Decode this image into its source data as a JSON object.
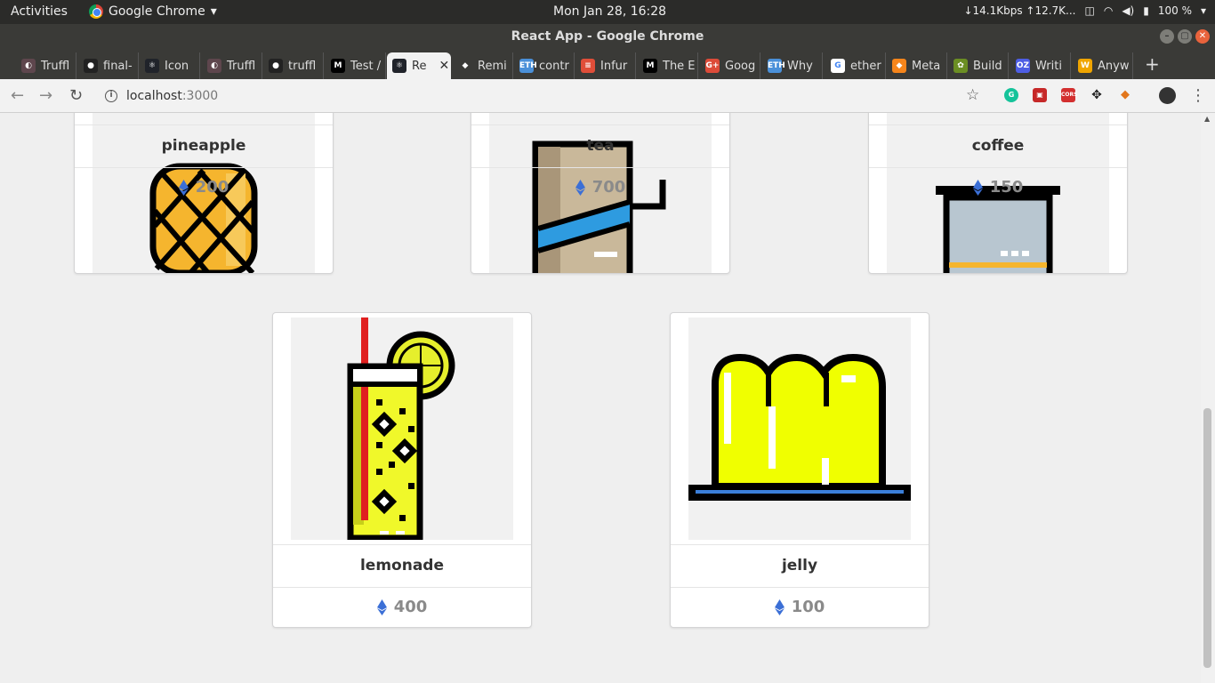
{
  "system": {
    "activities": "Activities",
    "app_name": "Google Chrome",
    "clock": "Mon Jan 28, 16:28",
    "net": "↓14.1Kbps ↑12.7K...",
    "battery": "100 %"
  },
  "window": {
    "title": "React App - Google Chrome"
  },
  "tabs": [
    {
      "label": "Truffl",
      "fav": "truffle-icon"
    },
    {
      "label": "final-",
      "fav": "github-icon"
    },
    {
      "label": "Icon",
      "fav": "react-icon"
    },
    {
      "label": "Truffl",
      "fav": "truffle-icon"
    },
    {
      "label": "truffl",
      "fav": "github-icon"
    },
    {
      "label": "Test /",
      "fav": "medium-icon"
    },
    {
      "label": "Re",
      "fav": "react-icon",
      "active": true
    },
    {
      "label": "Remi",
      "fav": "remix-icon"
    },
    {
      "label": "contr",
      "fav": "eth-icon"
    },
    {
      "label": "Infur",
      "fav": "infura-icon"
    },
    {
      "label": "The E",
      "fav": "medium-icon"
    },
    {
      "label": "Goog",
      "fav": "gplus-icon"
    },
    {
      "label": "Why",
      "fav": "eth-icon"
    },
    {
      "label": "ether",
      "fav": "google-icon"
    },
    {
      "label": "Meta",
      "fav": "metamask-icon"
    },
    {
      "label": "Build",
      "fav": "build-icon"
    },
    {
      "label": "Writi",
      "fav": "openzeppelin-icon"
    },
    {
      "label": "Anyw",
      "fav": "w-icon"
    }
  ],
  "address_bar": {
    "host": "localhost",
    "port": ":3000"
  },
  "products": [
    {
      "name": "pineapple",
      "price": "200",
      "image": "pineapple-image"
    },
    {
      "name": "tea",
      "price": "700",
      "image": "tea-image"
    },
    {
      "name": "coffee",
      "price": "150",
      "image": "coffee-image"
    },
    {
      "name": "lemonade",
      "price": "400",
      "image": "lemonade-image"
    },
    {
      "name": "jelly",
      "price": "100",
      "image": "jelly-image"
    }
  ],
  "colors": {
    "eth_blue": "#3b6fd6",
    "page_bg": "#efefef"
  }
}
